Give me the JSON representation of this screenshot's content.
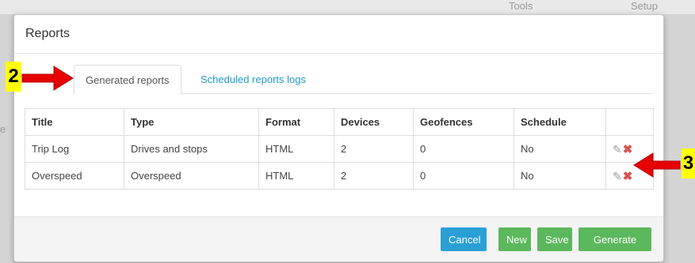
{
  "background": {
    "tools_label": "Tools",
    "setup_label": "Setup",
    "left_fragment": "e"
  },
  "modal": {
    "title": "Reports",
    "tabs": [
      {
        "label": "Generated reports",
        "active": true
      },
      {
        "label": "Scheduled reports logs",
        "active": false
      }
    ],
    "table": {
      "columns": [
        "Title",
        "Type",
        "Format",
        "Devices",
        "Geofences",
        "Schedule",
        ""
      ],
      "rows": [
        {
          "title": "Trip Log",
          "type": "Drives and stops",
          "format": "HTML",
          "devices": "2",
          "geofences": "0",
          "schedule": "No"
        },
        {
          "title": "Overspeed",
          "type": "Overspeed",
          "format": "HTML",
          "devices": "2",
          "geofences": "0",
          "schedule": "No"
        }
      ]
    },
    "footer": {
      "cancel": "Cancel",
      "new": "New",
      "save": "Save",
      "generate": "Generate"
    }
  },
  "annotations": {
    "marker_2": "2",
    "marker_3": "3"
  },
  "colors": {
    "accent_blue": "#2a9fd6",
    "success_green": "#5cb85c",
    "link_blue": "#1f9ac6",
    "delete_red": "#d9534f",
    "highlight_yellow": "#ffff00",
    "arrow_red": "#e60000"
  }
}
